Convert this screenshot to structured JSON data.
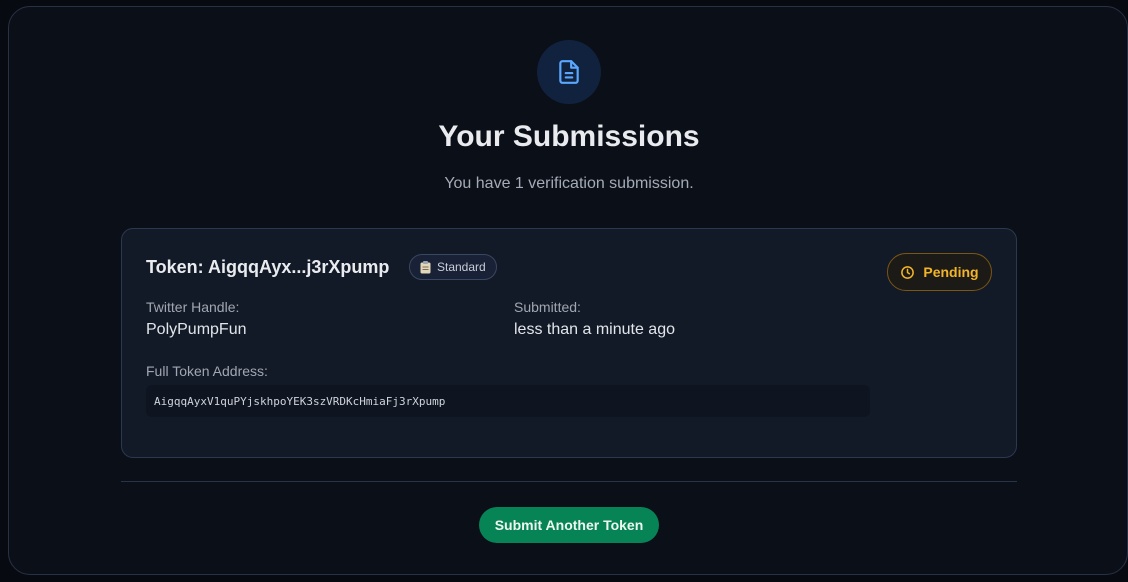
{
  "header": {
    "icon": "file-text-icon",
    "title": "Your Submissions",
    "subtitle": "You have 1 verification submission."
  },
  "submission": {
    "token_label": "Token: AigqqAyx...j3rXpump",
    "tier_icon": "clipboard-icon",
    "tier_label": "Standard",
    "status_icon": "clock-icon",
    "status_label": "Pending",
    "twitter_label": "Twitter Handle:",
    "twitter_value": "PolyPumpFun",
    "submitted_label": "Submitted:",
    "submitted_value": "less than a minute ago",
    "address_label": "Full Token Address:",
    "address_value": "AigqqAyxV1quPYjskhpoYEK3szVRDKcHmiaFj3rXpump"
  },
  "actions": {
    "submit_another_label": "Submit Another Token"
  },
  "colors": {
    "accent_blue": "#5aa7ff",
    "pending": "#f2b52a",
    "button": "#078455"
  }
}
